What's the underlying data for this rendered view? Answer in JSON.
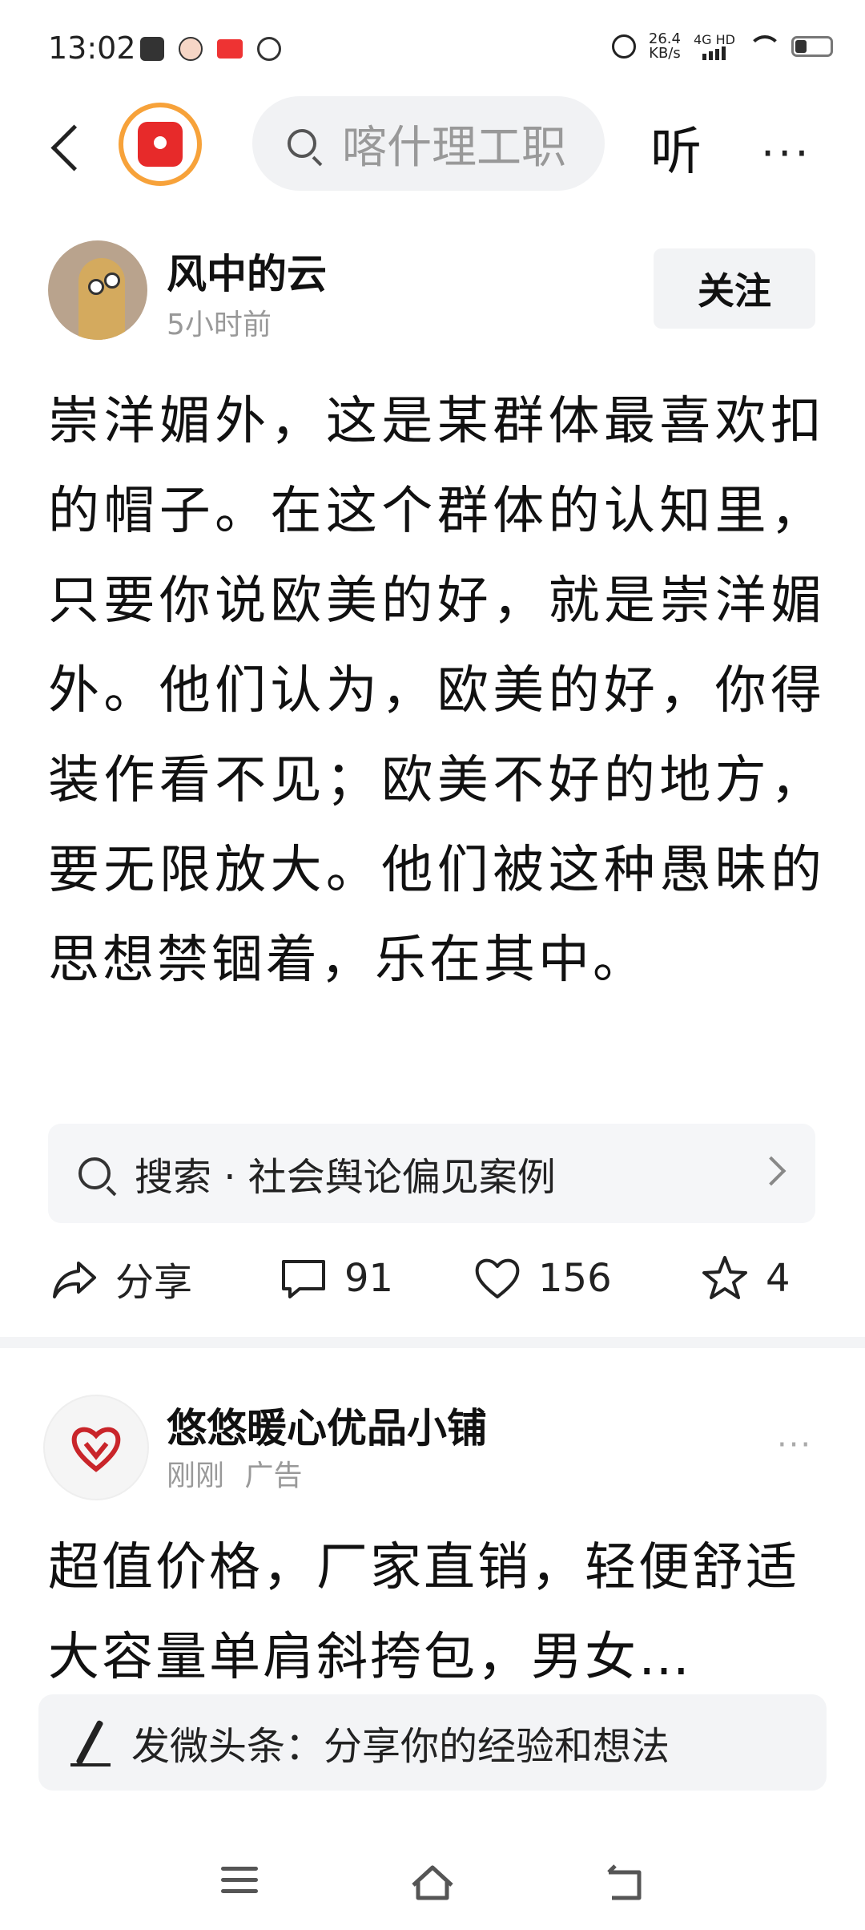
{
  "status_bar": {
    "time": "13:02",
    "speed_value": "26.4",
    "speed_unit": "KB/s",
    "network": "4G HD",
    "icons": [
      "message-icon",
      "avatar-icon",
      "toutiao-icon",
      "nfc-icon",
      "alarm-icon",
      "signal-icon",
      "wifi-icon",
      "battery-icon"
    ]
  },
  "header": {
    "search_placeholder": "喀什理工职",
    "listen_label": "听",
    "more_label": "···"
  },
  "post": {
    "author": "风中的云",
    "time": "5小时前",
    "follow_label": "关注",
    "content": "崇洋媚外，这是某群体最喜欢扣的帽子。在这个群体的认知里，只要你说欧美的好，就是崇洋媚外。他们认为，欧美的好，你得装作看不见；欧美不好的地方，要无限放大。他们被这种愚昧的思想禁锢着，乐在其中。",
    "search_suggestion": "搜索 · 社会舆论偏见案例",
    "actions": {
      "share_label": "分享",
      "comments": "91",
      "likes": "156",
      "favorites": "4"
    }
  },
  "ad": {
    "name": "悠悠暖心优品小铺",
    "time": "刚刚",
    "tag": "广告",
    "more_label": "···",
    "content": "超值价格，厂家直销，轻便舒适大容量单肩斜挎包，男女…"
  },
  "composer": {
    "placeholder": "发微头条：分享你的经验和想法"
  },
  "colors": {
    "accent_orange": "#f7a23a",
    "brand_red": "#e72a2a",
    "muted_text": "#999999"
  }
}
